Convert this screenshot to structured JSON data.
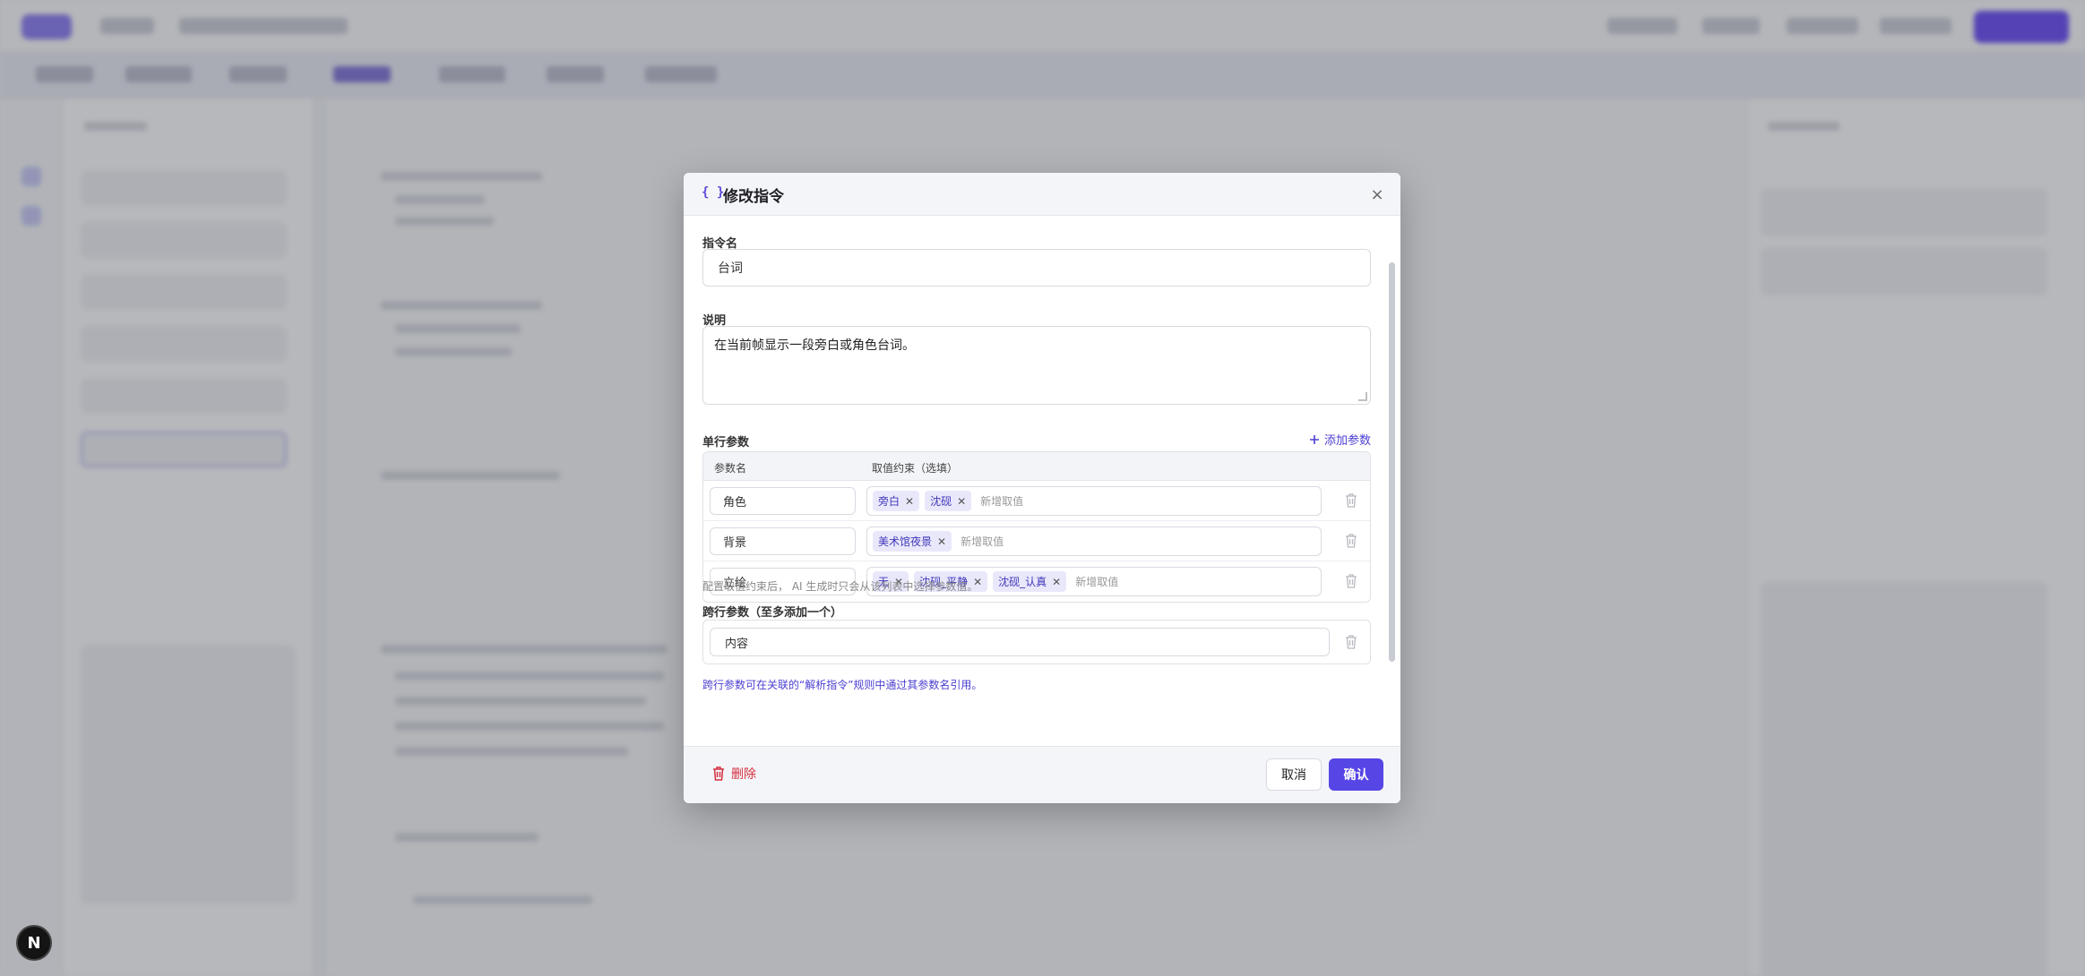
{
  "fab": {
    "label": "N"
  },
  "modal": {
    "title_icon": "{ }",
    "title": "修改指令",
    "close_icon": "×"
  },
  "form": {
    "name_label": "指令名",
    "name_value": "台词",
    "desc_label": "说明",
    "desc_value": "在当前帧显示一段旁白或角色台词。",
    "single_params_label": "单行参数",
    "add_param_label": "添加参数",
    "table_headers": {
      "name": "参数名",
      "values": "取值约束（选填）"
    },
    "params": [
      {
        "name": "角色",
        "values": [
          "旁白",
          "沈砚"
        ],
        "new_placeholder": "新增取值"
      },
      {
        "name": "背景",
        "values": [
          "美术馆夜景"
        ],
        "new_placeholder": "新增取值"
      },
      {
        "name": "立绘",
        "values": [
          "无",
          "沈砚_平静",
          "沈砚_认真"
        ],
        "new_placeholder": "新增取值"
      }
    ],
    "single_hint": "配置取值约束后， AI 生成时只会从该列表中选择参数值。",
    "multi_params_label": "跨行参数（至多添加一个）",
    "multi_param_value": "内容",
    "multi_hint": "跨行参数可在关联的“解析指令”规则中通过其参数名引用。"
  },
  "footer": {
    "delete_label": "删除",
    "cancel_label": "取消",
    "confirm_label": "确认"
  },
  "colors": {
    "accent": "#5646e6",
    "danger": "#d32f3f",
    "chip_bg": "#e9e8fb"
  },
  "icons": {
    "title": "braces-icon",
    "close": "close-icon",
    "add": "plus-icon",
    "row_delete": "trash-icon",
    "chip_remove": "x-icon",
    "footer_delete": "trash-icon"
  }
}
